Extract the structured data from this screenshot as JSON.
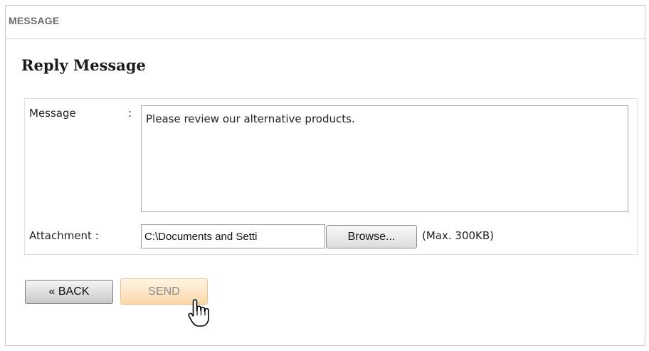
{
  "panel": {
    "header": "MESSAGE"
  },
  "form": {
    "title": "Reply Message",
    "message_label": "Message",
    "message_colon": ":",
    "message_value": "Please review our alternative products.",
    "attachment_label": "Attachment :",
    "attachment_value": "C:\\Documents and Setti",
    "browse_label": "Browse...",
    "max_note": "(Max. 300KB)"
  },
  "actions": {
    "back_label": "« BACK",
    "send_label": "SEND"
  },
  "cursor": {
    "icon": "hand-pointer-icon"
  }
}
